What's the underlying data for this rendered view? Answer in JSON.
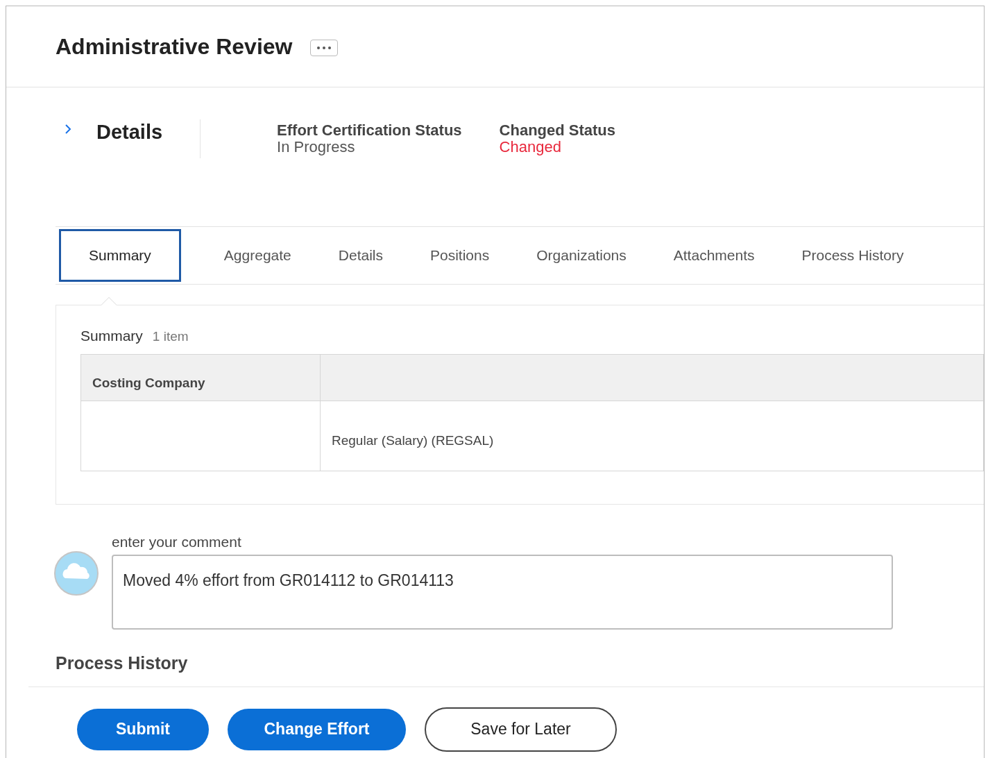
{
  "page": {
    "title": "Administrative Review"
  },
  "details": {
    "heading": "Details",
    "expanded": false,
    "fields": [
      {
        "label": "Effort Certification Status",
        "value": "In Progress",
        "kind": "normal"
      },
      {
        "label": "Changed Status",
        "value": "Changed",
        "kind": "alert"
      }
    ]
  },
  "tabs": [
    {
      "label": "Summary",
      "selected": true
    },
    {
      "label": "Aggregate",
      "selected": false
    },
    {
      "label": "Details",
      "selected": false
    },
    {
      "label": "Positions",
      "selected": false
    },
    {
      "label": "Organizations",
      "selected": false
    },
    {
      "label": "Attachments",
      "selected": false
    },
    {
      "label": "Process History",
      "selected": false
    }
  ],
  "summary": {
    "title": "Summary",
    "count": "1 item",
    "columns": [
      "Costing Company",
      null
    ],
    "rows": [
      {
        "cells": [
          null,
          "Regular (Salary) (REGSAL)"
        ]
      }
    ]
  },
  "comment": {
    "label": "enter your comment",
    "value": "Moved 4% effort from GR014112 to GR014113"
  },
  "process_history": {
    "heading": "Process History"
  },
  "buttons": [
    {
      "label": "Submit",
      "kind": "primary"
    },
    {
      "label": "Change Effort",
      "kind": "primary"
    },
    {
      "label": "Save for Later",
      "kind": "secondary"
    }
  ]
}
